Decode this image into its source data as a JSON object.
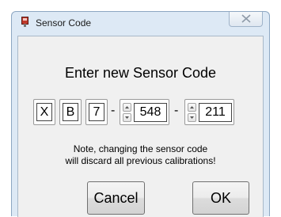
{
  "window": {
    "title": "Sensor Code",
    "icon": "sensor-app-icon"
  },
  "dialog": {
    "heading": "Enter new Sensor Code",
    "code": {
      "char1": "X",
      "char2": "B",
      "char3": "7",
      "separator": "-",
      "number1": "548",
      "number2": "211"
    },
    "note_line1": "Note, changing the sensor code",
    "note_line2": "will discard all previous calibrations!",
    "cancel_label": "Cancel",
    "ok_label": "OK"
  },
  "colors": {
    "window_frame": "#dde9f5",
    "client_bg": "#f0f0f0"
  }
}
